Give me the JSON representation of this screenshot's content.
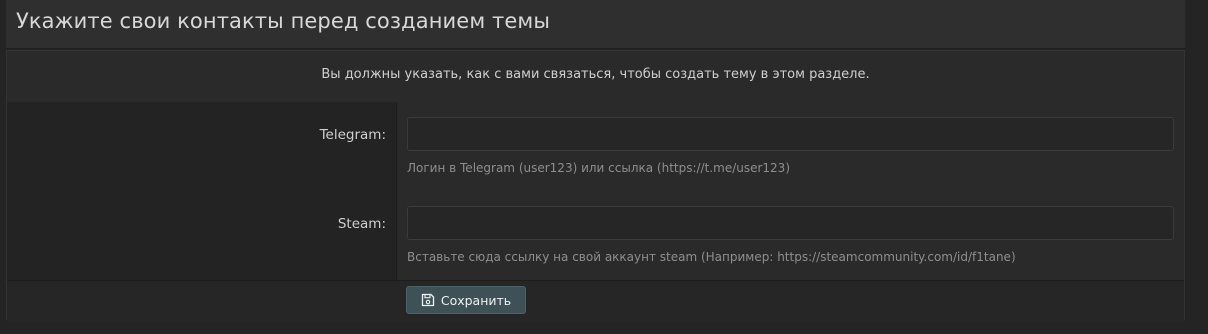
{
  "page": {
    "title": "Укажите свои контакты перед созданием темы"
  },
  "notice": {
    "text": "Вы должны указать, как с вами связаться, чтобы создать тему в этом разделе."
  },
  "form": {
    "telegram": {
      "label": "Telegram:",
      "value": "",
      "hint": "Логин в Telegram (user123) или ссылка (https://t.me/user123)"
    },
    "steam": {
      "label": "Steam:",
      "value": "",
      "hint": "Вставьте сюда ссылку на свой аккаунт steam (Например: https://steamcommunity.com/id/f1tane)"
    },
    "save_label": "Сохранить",
    "save_icon": "floppy-disk-icon"
  },
  "colors": {
    "accent_button": "#3e5157"
  }
}
